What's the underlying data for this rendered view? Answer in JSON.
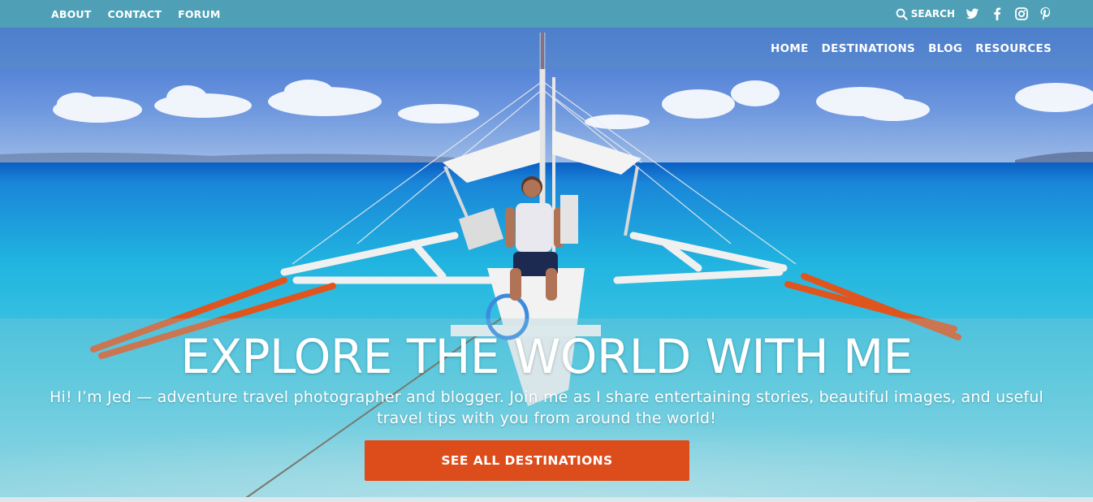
{
  "topbar": {
    "links": [
      "ABOUT",
      "CONTACT",
      "FORUM"
    ],
    "search_label": "SEARCH",
    "social": [
      "twitter-icon",
      "facebook-icon",
      "instagram-icon",
      "pinterest-icon"
    ],
    "bg_color": "#4fa0b6"
  },
  "nav": {
    "items": [
      "HOME",
      "DESTINATIONS",
      "BLOG",
      "RESOURCES"
    ]
  },
  "hero": {
    "headline": "EXPLORE THE WORLD WITH ME",
    "subtitle": "Hi! I’m Jed — adventure travel photographer and blogger. Join me as I share entertaining stories, beautiful images, and useful travel tips with you from around the world!",
    "cta_label": "SEE ALL DESTINATIONS",
    "cta_color": "#dd4d1c"
  }
}
